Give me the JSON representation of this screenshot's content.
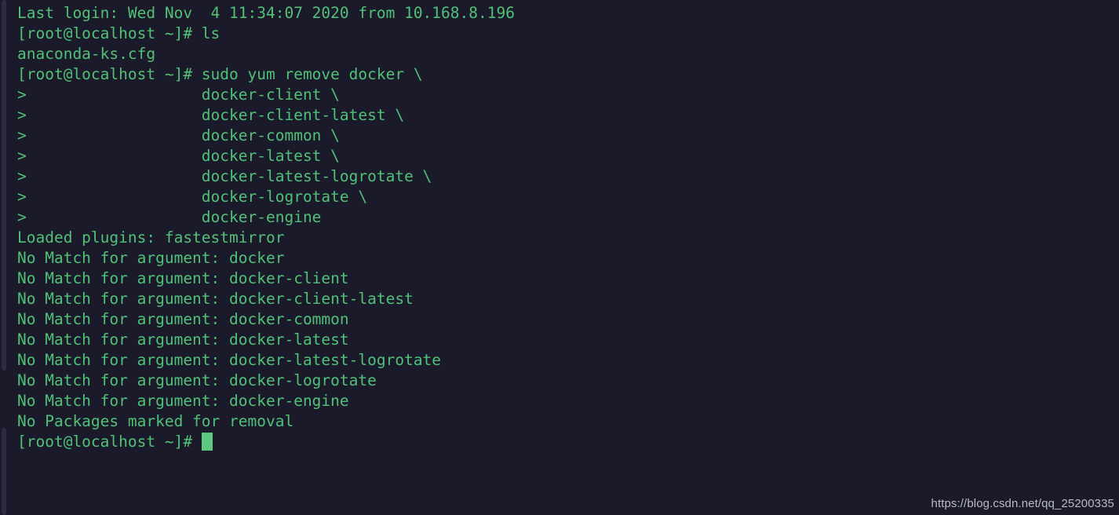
{
  "terminal": {
    "background_color": "#1a1a2a",
    "text_color": "#51c178",
    "cursor_color": "#5cc77e",
    "scrollbar_color": "#2c2c3e",
    "lines": [
      "Last login: Wed Nov  4 11:34:07 2020 from 10.168.8.196",
      "[root@localhost ~]# ls",
      "anaconda-ks.cfg",
      "[root@localhost ~]# sudo yum remove docker \\",
      ">                   docker-client \\",
      ">                   docker-client-latest \\",
      ">                   docker-common \\",
      ">                   docker-latest \\",
      ">                   docker-latest-logrotate \\",
      ">                   docker-logrotate \\",
      ">                   docker-engine",
      "Loaded plugins: fastestmirror",
      "No Match for argument: docker",
      "No Match for argument: docker-client",
      "No Match for argument: docker-client-latest",
      "No Match for argument: docker-common",
      "No Match for argument: docker-latest",
      "No Match for argument: docker-latest-logrotate",
      "No Match for argument: docker-logrotate",
      "No Match for argument: docker-engine",
      "No Packages marked for removal"
    ],
    "prompt_line": "[root@localhost ~]# "
  },
  "watermark": {
    "text": "https://blog.csdn.net/qq_25200335"
  }
}
